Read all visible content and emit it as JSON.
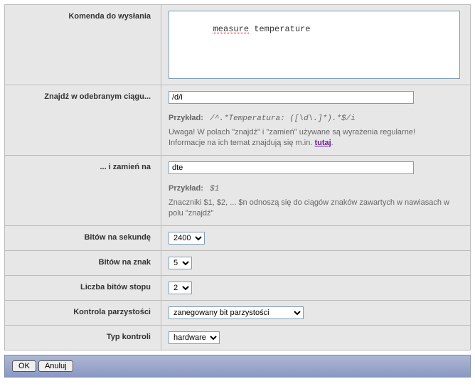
{
  "form": {
    "command": {
      "label": "Komenda do wysłania",
      "value_w1": "measure",
      "value_w2": "temperature"
    },
    "find": {
      "label": "Znajdź w odebranym ciągu...",
      "value": "/d/i",
      "example_label": "Przykład:",
      "example_value": "/^.*Temperatura: ([\\d\\.]*).*$/i",
      "warning_a": "Uwaga! W polach \"znajdź\" i \"zamień\" używane są wyrażenia regularne!",
      "warning_b": "Informacje na ich temat znajdują się m.in. ",
      "link_text": "tutaj",
      "warning_c": "."
    },
    "replace": {
      "label": "... i zamień na",
      "value": "dte",
      "example_label": "Przykład:",
      "example_value": "$1",
      "note": "Znaczniki $1, $2, ... $n odnoszą się do ciągów znaków zawartych w nawiasach w polu \"znajdź\""
    },
    "baud": {
      "label": "Bitów na sekundę",
      "value": "2400"
    },
    "databits": {
      "label": "Bitów na znak",
      "value": "5"
    },
    "stopbits": {
      "label": "Liczba bitów stopu",
      "value": "2"
    },
    "parity": {
      "label": "Kontrola parzystości",
      "value": "zanegowany bit parzystości"
    },
    "flow": {
      "label": "Typ kontroli",
      "value": "hardware"
    }
  },
  "buttons": {
    "ok": "OK",
    "cancel": "Anuluj"
  }
}
